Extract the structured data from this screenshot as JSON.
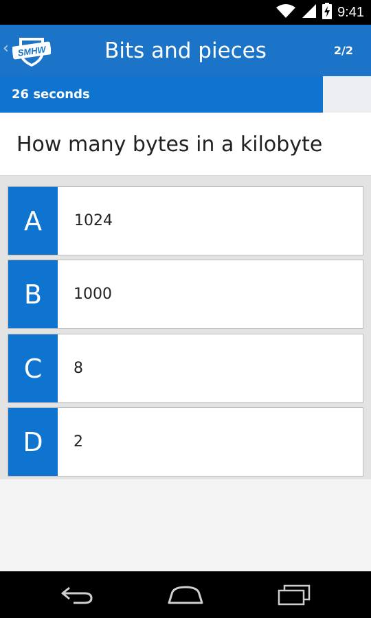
{
  "status_bar": {
    "time": "9:41",
    "icons": [
      "wifi-icon",
      "signal-icon",
      "battery-charging-icon"
    ]
  },
  "app_bar": {
    "logo_text": "SMHW",
    "title": "Bits and pieces",
    "counter": "2/2"
  },
  "timer": {
    "label": "26 seconds",
    "progress_fraction": 0.87
  },
  "question": {
    "text": "How many bytes in a kilobyte"
  },
  "answers": [
    {
      "letter": "A",
      "text": "1024"
    },
    {
      "letter": "B",
      "text": "1000"
    },
    {
      "letter": "C",
      "text": "8"
    },
    {
      "letter": "D",
      "text": "2"
    }
  ],
  "nav_bar": {
    "icons": [
      "back-icon",
      "home-icon",
      "recent-apps-icon"
    ]
  },
  "colors": {
    "brand_blue": "#1b74c8",
    "accent_blue": "#0f74d0"
  }
}
